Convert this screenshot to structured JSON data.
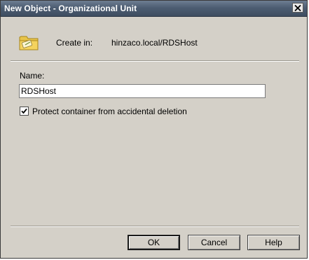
{
  "window": {
    "title": "New Object - Organizational Unit"
  },
  "icons": {
    "ou": "organizational-unit-folder-icon",
    "close": "close-icon",
    "check": "checkmark-icon"
  },
  "create_in": {
    "label": "Create in:",
    "value": "hinzaco.local/RDSHost"
  },
  "form": {
    "name_label": "Name:",
    "name_value": "RDSHost",
    "protect_label": "Protect container from accidental deletion",
    "protect_checked": true
  },
  "buttons": {
    "ok": "OK",
    "cancel": "Cancel",
    "help": "Help"
  }
}
